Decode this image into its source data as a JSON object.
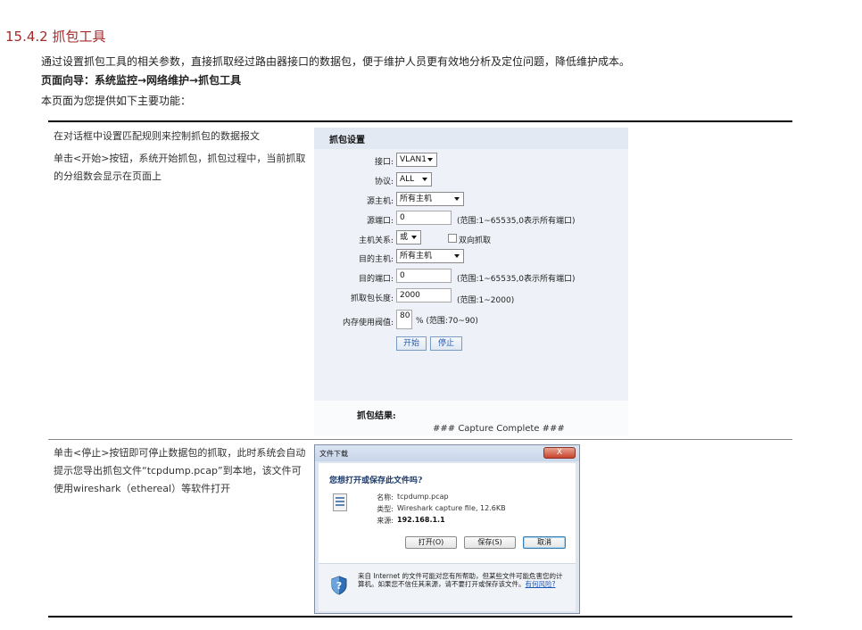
{
  "section": {
    "title": "15.4.2  抓包工具",
    "intro": "通过设置抓包工具的相关参数，直接抓取经过路由器接口的数据包，便于维护人员更有效地分析及定位问题，降低维护成本。",
    "nav": "页面向导：系统监控→网络维护→抓包工具",
    "features_lead": "本页面为您提供如下主要功能："
  },
  "rows": [
    {
      "desc_a": "在对话框中设置匹配规则来控制抓包的数据报文",
      "desc_b": "单击<开始>按钮，系统开始抓包，抓包过程中，当前抓取的分组数会显示在页面上"
    },
    {
      "desc": "单击<停止>按钮即可停止数据包的抓取，此时系统会自动提示您导出抓包文件“tcpdump.pcap”到本地，该文件可使用wireshark（ethereal）等软件打开"
    }
  ],
  "capture_panel": {
    "title": "抓包设置",
    "interface_label": "接口:",
    "interface_value": "VLAN1",
    "protocol_label": "协议:",
    "protocol_value": "ALL",
    "src_host_label": "源主机:",
    "src_host_value": "所有主机",
    "src_port_label": "源端口:",
    "src_port_value": "0",
    "src_port_hint": "(范围:1~65535,0表示所有端口)",
    "host_rel_label": "主机关系:",
    "host_rel_value": "或",
    "bidirectional_label": "双向抓取",
    "dst_host_label": "目的主机:",
    "dst_host_value": "所有主机",
    "dst_port_label": "目的端口:",
    "dst_port_value": "0",
    "dst_port_hint": "(范围:1~65535,0表示所有端口)",
    "cap_len_label": "抓取包长度:",
    "cap_len_value": "2000",
    "cap_len_hint": "(范围:1~2000)",
    "mem_label": "内存使用阀值:",
    "mem_value": "80",
    "mem_hint": "% (范围:70~90)",
    "start_label": "开始",
    "stop_label": "停止",
    "result_label": "抓包结果:",
    "result_text": "### Capture Complete ###"
  },
  "download_dialog": {
    "title": "文件下载",
    "close_label": "X",
    "question": "您想打开或保存此文件吗?",
    "name_label": "名称:",
    "name_value": "tcpdump.pcap",
    "type_label": "类型:",
    "type_value": "Wireshark capture file, 12.6KB",
    "source_label": "来源:",
    "source_value": "192.168.1.1",
    "open_label": "打开(O)",
    "save_label": "保存(S)",
    "cancel_label": "取消",
    "warning": "来自 Internet 的文件可能对您有所帮助，但某些文件可能危害您的计算机。如果您不信任其来源，请不要打开或保存该文件。",
    "risk_link": "有何风险?"
  },
  "colors": {
    "section_title": "#a42a2a",
    "button_text": "#2a57a6",
    "link": "#1a56b8"
  }
}
